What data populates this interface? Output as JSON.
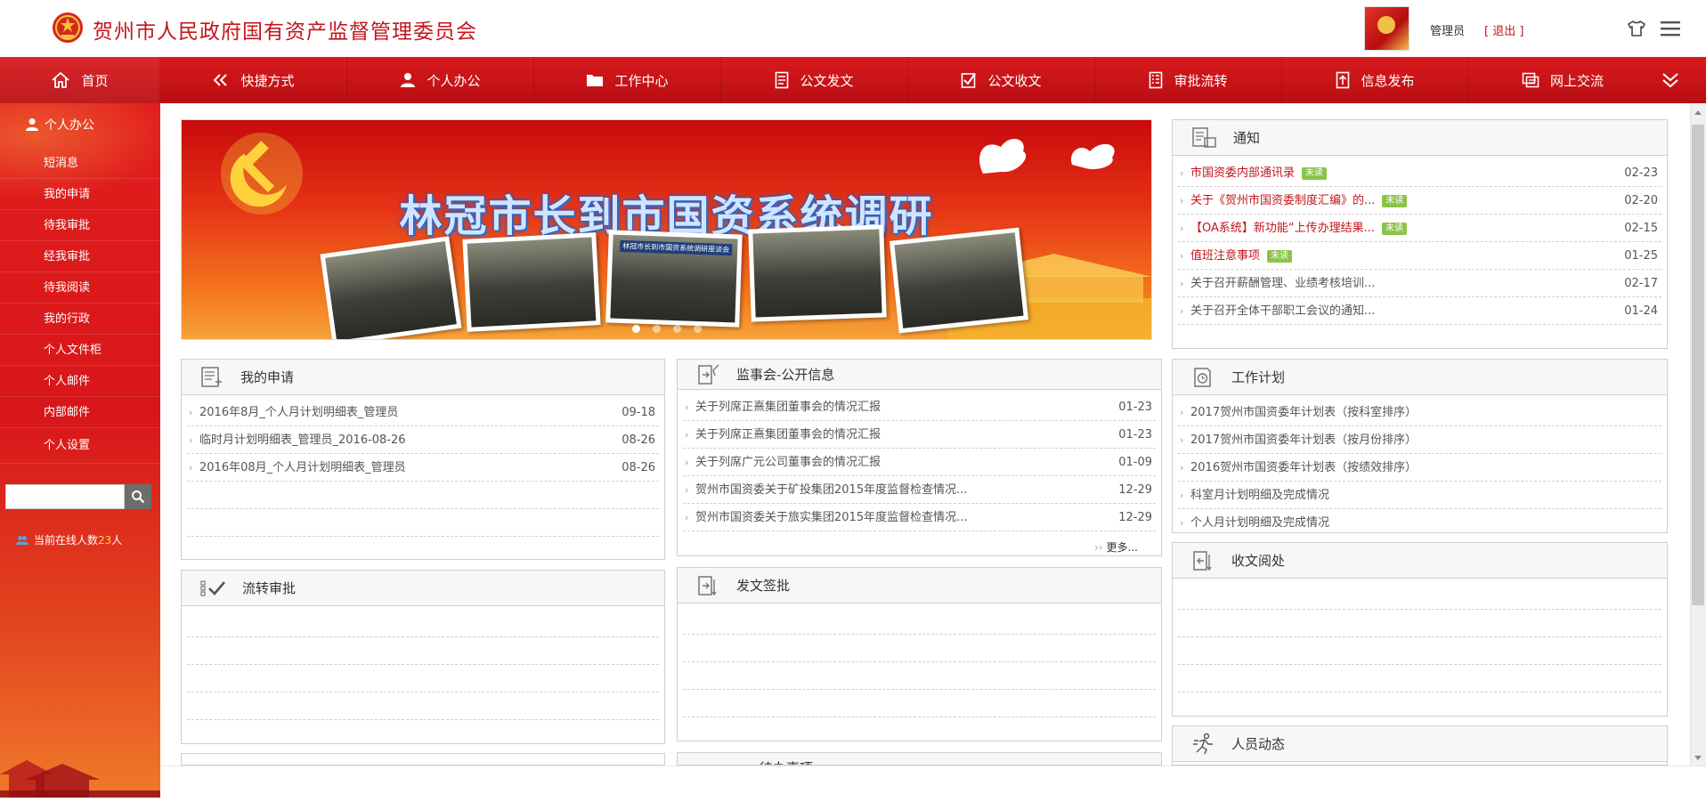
{
  "header": {
    "title": "贺州市人民政府国有资产监督管理委员会",
    "user_name": "管理员",
    "logout": "[ 退出 ]"
  },
  "topnav": [
    {
      "label": "首页",
      "icon": "home-icon"
    },
    {
      "label": "快捷方式",
      "icon": "shortcut-icon"
    },
    {
      "label": "个人办公",
      "icon": "person-icon"
    },
    {
      "label": "工作中心",
      "icon": "folder-icon"
    },
    {
      "label": "公文发文",
      "icon": "document-icon"
    },
    {
      "label": "公文收文",
      "icon": "checkbox-document-icon"
    },
    {
      "label": "审批流转",
      "icon": "list-document-icon"
    },
    {
      "label": "信息发布",
      "icon": "upload-icon"
    },
    {
      "label": "网上交流",
      "icon": "chat-icon"
    }
  ],
  "sidebar": {
    "title": "个人办公",
    "items": [
      "短消息",
      "我的申请",
      "待我审批",
      "经我审批",
      "待我阅读",
      "我的行政",
      "个人文件柜",
      "个人邮件",
      "内部邮件",
      "个人设置"
    ],
    "online_prefix": "当前在线人数",
    "online_count": "23",
    "online_suffix": "人"
  },
  "banner": {
    "text": "林冠市长到市国资系统调研",
    "photo_caption": "林冠市长到市国资系统调研座谈会"
  },
  "notice": {
    "title": "通知",
    "unread_label": "未读",
    "rows": [
      {
        "text": "市国资委内部通讯录",
        "date": "02-23",
        "unread": true
      },
      {
        "text": "关于《贺州市国资委制度汇编》的...",
        "date": "02-20",
        "unread": true
      },
      {
        "text": "【OA系统】新功能“上传办理结果...",
        "date": "02-15",
        "unread": true
      },
      {
        "text": "值班注意事项",
        "date": "01-25",
        "unread": true
      },
      {
        "text": "关于召开薪酬管理、业绩考核培训...",
        "date": "02-17",
        "unread": false
      },
      {
        "text": "关于召开全体干部职工会议的通知...",
        "date": "01-24",
        "unread": false
      }
    ]
  },
  "my_apply": {
    "title": "我的申请",
    "rows": [
      {
        "text": "2016年8月_个人月计划明细表_管理员",
        "date": "09-18"
      },
      {
        "text": "临时月计划明细表_管理员_2016-08-26",
        "date": "08-26"
      },
      {
        "text": "2016年08月_个人月计划明细表_管理员",
        "date": "08-26"
      }
    ]
  },
  "supervisor": {
    "title": "监事会-公开信息",
    "more": "更多...",
    "rows": [
      {
        "text": "关于列席正熹集团董事会的情况汇报",
        "date": "01-23"
      },
      {
        "text": "关于列席正熹集团董事会的情况汇报",
        "date": "01-23"
      },
      {
        "text": "关于列席广元公司董事会的情况汇报",
        "date": "01-09"
      },
      {
        "text": "贺州市国资委关于矿投集团2015年度监督检查情况...",
        "date": "12-29"
      },
      {
        "text": "贺州市国资委关于旅实集团2015年度监督检查情况...",
        "date": "12-29"
      }
    ]
  },
  "work_plan": {
    "title": "工作计划",
    "rows": [
      {
        "text": "2017贺州市国资委年计划表（按科室排序）"
      },
      {
        "text": "2017贺州市国资委年计划表（按月份排序）"
      },
      {
        "text": "2016贺州市国资委年计划表（按绩效排序）"
      },
      {
        "text": "科室月计划明细及完成情况"
      },
      {
        "text": "个人月计划明细及完成情况"
      }
    ]
  },
  "flow_approval": {
    "title": "流转审批"
  },
  "doc_sign": {
    "title": "发文签批"
  },
  "receive_doc": {
    "title": "收文阅处"
  },
  "staff": {
    "title": "人员动态"
  },
  "pending": {
    "title": "待办事项"
  },
  "colors": {
    "brand_red": "#c4151c",
    "nav_red": "#c81216",
    "unread_green": "#8bc34a"
  }
}
